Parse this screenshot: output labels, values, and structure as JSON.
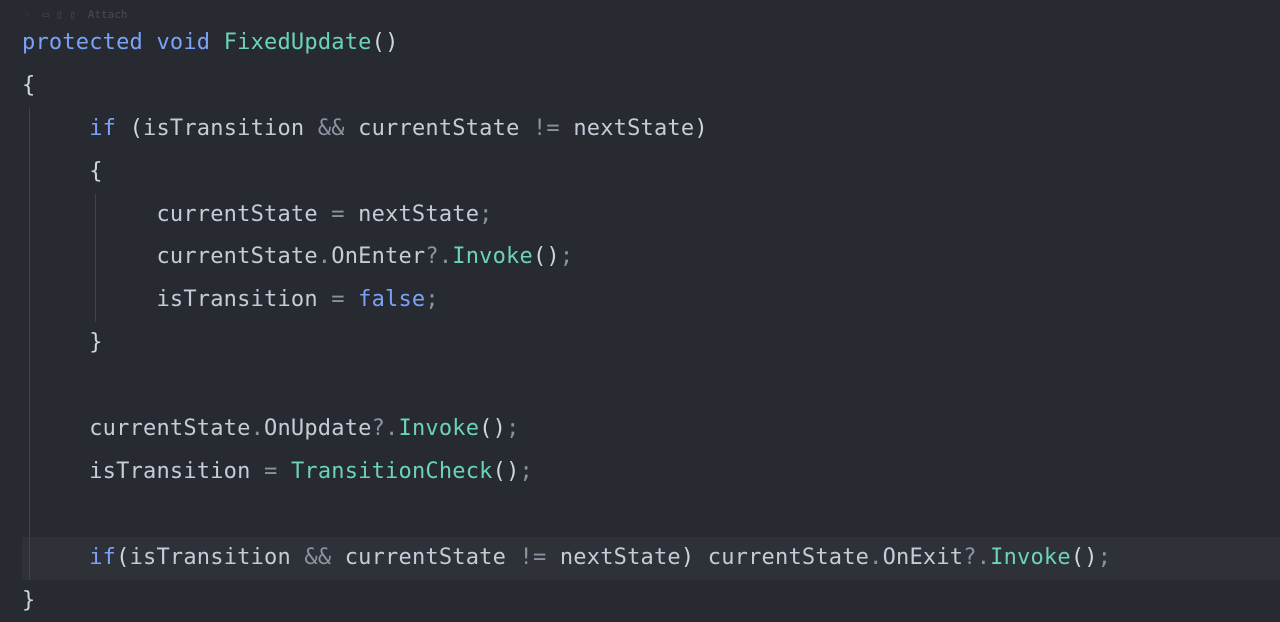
{
  "toolbar": {
    "attach_label": "Attach"
  },
  "code": {
    "kw_protected": "protected",
    "kw_void": "void",
    "fn_fixedupdate": "FixedUpdate",
    "paren_open": "(",
    "paren_close": ")",
    "brace_open": "{",
    "brace_close": "}",
    "kw_if": "if",
    "id_isTransition": "isTransition",
    "op_and": "&&",
    "id_currentState": "currentState",
    "op_neq": "!=",
    "id_nextState": "nextState",
    "op_assign": "=",
    "op_dot": ".",
    "prop_OnEnter": "OnEnter",
    "prop_OnUpdate": "OnUpdate",
    "prop_OnExit": "OnExit",
    "op_qmark": "?",
    "fn_Invoke": "Invoke",
    "semicolon": ";",
    "bool_false": "false",
    "fn_TransitionCheck": "TransitionCheck"
  }
}
